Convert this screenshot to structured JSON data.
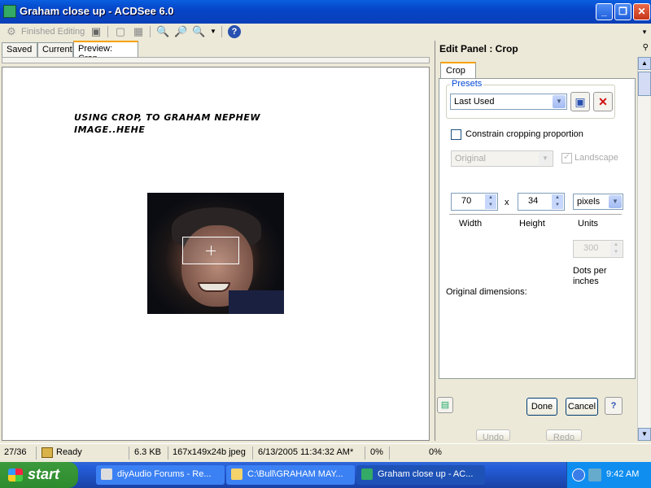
{
  "window": {
    "title": "Graham close up - ACDSee 6.0",
    "minimize": "_",
    "maximize": "❐",
    "close": "✕"
  },
  "toolbar": {
    "finished_editing": "Finished Editing",
    "help": "?"
  },
  "tabs": [
    {
      "label": "Saved"
    },
    {
      "label": "Current"
    },
    {
      "label": "Preview: Crop"
    }
  ],
  "canvas": {
    "caption_line1": "USING CROP, TO GRAHAM NEPHEW",
    "caption_line2": "IMAGE..HEHE"
  },
  "panel": {
    "title": "Edit Panel : Crop",
    "tab": "Crop",
    "presets": {
      "legend": "Presets",
      "selected": "Last Used"
    },
    "constrain_label": "Constrain cropping proportion",
    "ratio_selected": "Original",
    "landscape_label": "Landscape",
    "width_value": "70",
    "height_value": "34",
    "times": "x",
    "units_selected": "pixels",
    "width_label": "Width",
    "height_label": "Height",
    "units_label": "Units",
    "dpi_value": "300",
    "dpi_label_1": "Dots per",
    "dpi_label_2": "inches",
    "original_dims_label": "Original dimensions:",
    "done": "Done",
    "cancel": "Cancel",
    "help": "?",
    "undo": "Undo",
    "redo": "Redo"
  },
  "status": {
    "position": "27/36",
    "state": "Ready",
    "size": "6.3 KB",
    "dims": "167x149x24b jpeg",
    "date": "6/13/2005 11:34:32 AM*",
    "progress": "0%",
    "progress2": "0%"
  },
  "taskbar": {
    "start": "start",
    "tasks": [
      {
        "label": "diyAudio Forums - Re..."
      },
      {
        "label": "C:\\Bull\\GRAHAM MAY..."
      },
      {
        "label": "Graham close up - AC..."
      }
    ],
    "time": "9:42 AM"
  },
  "colors": {
    "accent": "#0a5fe0",
    "tab_highlight": "#f7a200",
    "delete_red": "#d01010"
  }
}
